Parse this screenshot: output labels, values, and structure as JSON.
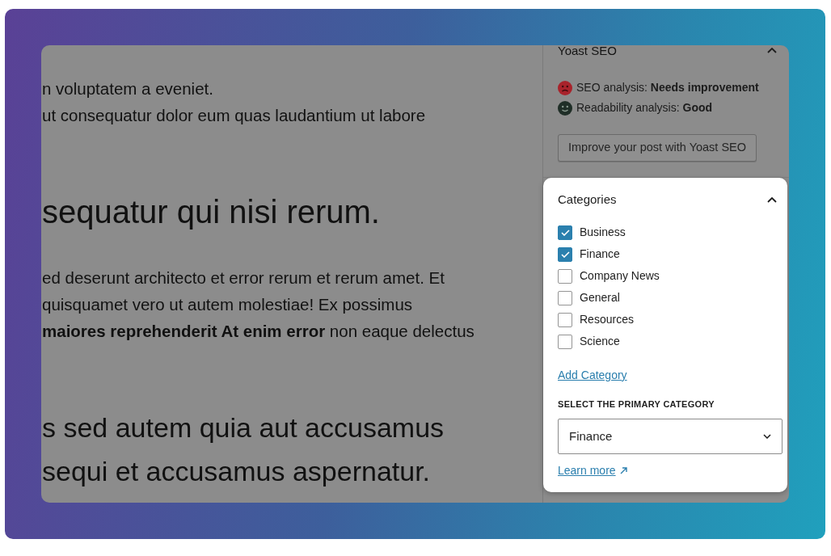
{
  "editor": {
    "blocks": [
      {
        "kind": "paragraph",
        "lines": [
          "n voluptatem a eveniet.",
          "ut consequatur dolor eum quas laudantium ut labore"
        ]
      },
      {
        "kind": "h2",
        "lines": [
          "sequatur qui nisi rerum."
        ]
      },
      {
        "kind": "paragraph",
        "lines": [
          "ed deserunt architecto et error rerum et rerum amet. Et",
          "quisquamet vero ut autem molestiae! Ex possimus",
          "**maiores reprehenderit At enim error** non eaque delectus"
        ]
      },
      {
        "kind": "h3",
        "lines": [
          "s sed autem quia aut accusamus",
          "sequi et accusamus aspernatur."
        ]
      }
    ]
  },
  "sidebar": {
    "yoast_panel": {
      "title": "Yoast SEO",
      "expanded": true,
      "analyses": [
        {
          "kind": "bad",
          "text": "SEO analysis: **Needs improvement**"
        },
        {
          "kind": "good",
          "text": "Readability analysis: **Good**"
        }
      ],
      "button": "Improve your post with Yoast SEO"
    },
    "categories_panel": {
      "title": "Categories",
      "expanded": true,
      "categories": [
        {
          "label": "Business",
          "checked": true
        },
        {
          "label": "Finance",
          "checked": true
        },
        {
          "label": "Company News",
          "checked": false
        },
        {
          "label": "General",
          "checked": false
        },
        {
          "label": "Resources",
          "checked": false
        },
        {
          "label": "Science",
          "checked": false
        }
      ],
      "add_link": "Add Category",
      "primary_label": "SELECT THE PRIMARY CATEGORY",
      "primary_select": {
        "value": "Finance"
      },
      "learn_more": "Learn more"
    }
  }
}
